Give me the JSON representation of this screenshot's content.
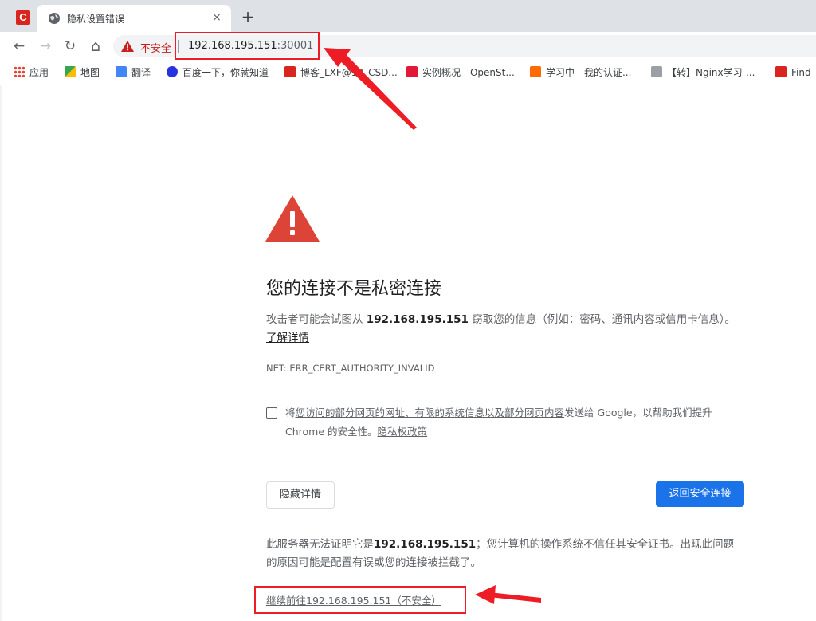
{
  "browser": {
    "app_logo": "C",
    "tab": {
      "title": "隐私设置错误",
      "close": "×"
    },
    "new_tab": "+",
    "nav": {
      "back": "←",
      "forward": "→",
      "reload": "↻",
      "home": "⌂"
    },
    "omnibox": {
      "security_label": "不安全",
      "host": "192.168.195.151",
      "port": ":30001"
    },
    "bookmarks": [
      {
        "label": "应用",
        "icon": "apps-grid-icon",
        "color": "#4285f4"
      },
      {
        "label": "地图",
        "icon": "maps-icon",
        "color": "#34a853"
      },
      {
        "label": "翻译",
        "icon": "translate-icon",
        "color": "#4285f4"
      },
      {
        "label": "百度一下，你就知道",
        "icon": "baidu-paw-icon",
        "color": "#2932e1"
      },
      {
        "label": "博客_LXF@12_CSD...",
        "icon": "csdn-icon",
        "color": "#d9251d"
      },
      {
        "label": "实例概况 - OpenSt...",
        "icon": "openstack-icon",
        "color": "#e31837"
      },
      {
        "label": "学习中 - 我的认证...",
        "icon": "aliyun-icon",
        "color": "#ff6a00"
      },
      {
        "label": "【转】Nginx学习-...",
        "icon": "script-icon",
        "color": "#5f6368"
      },
      {
        "label": "Find-",
        "icon": "csdn-icon",
        "color": "#d9251d"
      }
    ]
  },
  "page": {
    "heading": "您的连接不是私密连接",
    "intro_pre": "攻击者可能会试图从 ",
    "intro_host": "192.168.195.151",
    "intro_post": " 窃取您的信息（例如：密码、通讯内容或信用卡信息）。",
    "learn_more": "了解详情",
    "error_code": "NET::ERR_CERT_AUTHORITY_INVALID",
    "report_pre": "将",
    "report_link": "您访问的部分网页的网址、有限的系统信息以及部分网页内容",
    "report_mid": "发送给 Google，以帮助我们提升 Chrome 的安全性。",
    "privacy_policy": "隐私权政策",
    "hide_details": "隐藏详情",
    "back_to_safety": "返回安全连接",
    "details_pre": "此服务器无法证明它是",
    "details_host": "192.168.195.151",
    "details_post": "；您计算机的操作系统不信任其安全证书。出现此问题的原因可能是配置有误或您的连接被拦截了。",
    "proceed_link": "继续前往192.168.195.151（不安全）"
  },
  "colors": {
    "annotation": "#ee1c25",
    "primary": "#1a73e8",
    "danger": "#db4437"
  }
}
